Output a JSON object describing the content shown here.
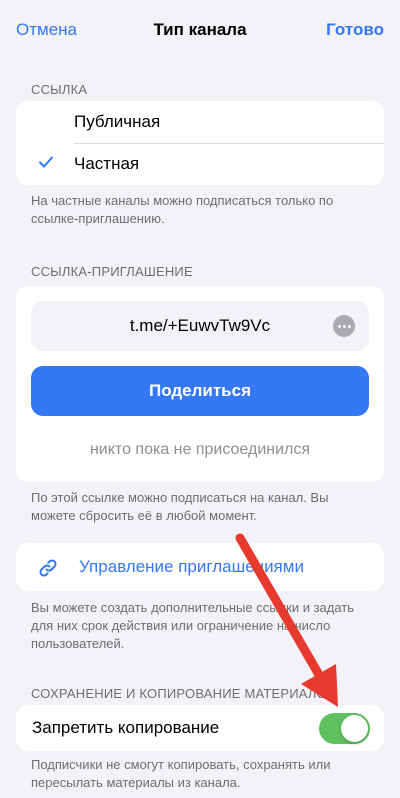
{
  "nav": {
    "cancel": "Отмена",
    "title": "Тип канала",
    "done": "Готово"
  },
  "link_type": {
    "header": "ССЫЛКА",
    "options": [
      {
        "label": "Публичная",
        "selected": false
      },
      {
        "label": "Частная",
        "selected": true
      }
    ],
    "footer": "На частные каналы можно подписаться только по ссылке-приглашению."
  },
  "invite": {
    "header": "ССЫЛКА-ПРИГЛАШЕНИЕ",
    "link": "t.me/+EuwvTw9Vc",
    "share_label": "Поделиться",
    "joined_text": "никто пока не присоединился",
    "footer": "По этой ссылке можно подписаться на канал. Вы можете сбросить её в любой момент."
  },
  "manage": {
    "label": "Управление приглашениями",
    "footer": "Вы можете создать дополнительные ссылки и задать для них срок действия или ограничение на число пользователей."
  },
  "content": {
    "header": "СОХРАНЕНИЕ И КОПИРОВАНИЕ МАТЕРИАЛОВ",
    "toggle_label": "Запретить копирование",
    "toggle_on": true,
    "footer": "Подписчики не смогут копировать, сохранять или пересылать материалы из канала."
  },
  "colors": {
    "accent": "#3478f6",
    "toggle_on": "#5fc05f",
    "annotation_arrow": "#e8392e"
  }
}
